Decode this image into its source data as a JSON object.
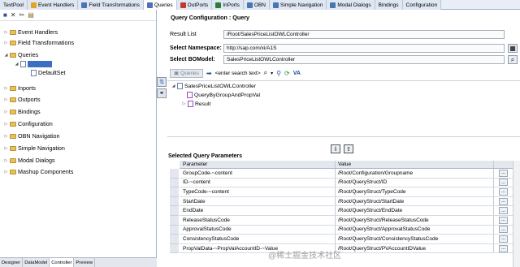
{
  "tabs": [
    {
      "label": "TextPool",
      "icon": "none",
      "color": "",
      "active": false
    },
    {
      "label": "Event Handlers",
      "icon": "lightning-icon",
      "color": "#e2a420",
      "active": false
    },
    {
      "label": "Field Transformations",
      "icon": "transform-icon",
      "color": "#4a74b4",
      "active": false
    },
    {
      "label": "Queries",
      "icon": "query-icon",
      "color": "#4a74b4",
      "active": true
    },
    {
      "label": "OutPorts",
      "icon": "outport-icon",
      "color": "#c0392b",
      "active": false
    },
    {
      "label": "InPorts",
      "icon": "inport-icon",
      "color": "#2e7d32",
      "active": false
    },
    {
      "label": "OBN",
      "icon": "obn-icon",
      "color": "#4a74b4",
      "active": false
    },
    {
      "label": "Simple Navigation",
      "icon": "navigation-icon",
      "color": "#4a74b4",
      "active": false
    },
    {
      "label": "Modal Dialogs",
      "icon": "dialog-icon",
      "color": "#4a74b4",
      "active": false
    },
    {
      "label": "Bindings",
      "icon": "none",
      "color": "",
      "active": false
    },
    {
      "label": "Configuration",
      "icon": "none",
      "color": "",
      "active": false
    }
  ],
  "left_toolbar": {
    "icons": [
      "save-icon",
      "delete-icon",
      "cut-icon",
      "paste-icon"
    ]
  },
  "tree": {
    "items": [
      {
        "label": "Event Handlers"
      },
      {
        "label": "Field Transformations"
      },
      {
        "label": "Queries"
      },
      {
        "label": ""
      },
      {
        "label": "DefaultSet"
      },
      {
        "label": "Inports"
      },
      {
        "label": "Outports"
      },
      {
        "label": "Bindings"
      },
      {
        "label": "Configuration"
      },
      {
        "label": "OBN Navigation"
      },
      {
        "label": "Simple Navigation"
      },
      {
        "label": "Modal Dialogs"
      },
      {
        "label": "Mashup Components"
      }
    ]
  },
  "bottom_tabs": [
    "Designer",
    "DataModel",
    "Controller",
    "Preview"
  ],
  "query_config": {
    "title": "Query Configuration : Query",
    "result_list_label": "Result List",
    "result_list_value": "/Root/SalesPriceListOWLController",
    "namespace_label": "Select Namespace:",
    "namespace_value": "http://sap.com/xi/A1S",
    "bomodel_label": "Select BOModel:",
    "bomodel_value": "SalesPriceListOWLController"
  },
  "query_toolbar": {
    "queries_button": "Queries",
    "search_placeholder": "<enter search text>"
  },
  "query_tree": {
    "root": "SalesPriceListOWLController",
    "children": [
      "QueryByGroupAndPropVal",
      "Result"
    ]
  },
  "params": {
    "section_title": "Selected Query Parameters",
    "col_parameter": "Parameter",
    "col_value": "Value",
    "rows": [
      {
        "parameter": "GroupCode-~content",
        "value": "/Root/Configuration/Groupname"
      },
      {
        "parameter": "ID-~content",
        "value": "/Root/QueryStruct/ID"
      },
      {
        "parameter": "TypeCode-~content",
        "value": "/Root/QueryStruct/TypeCode"
      },
      {
        "parameter": "StartDate",
        "value": "/Root/QueryStruct/StartDate"
      },
      {
        "parameter": "EndDate",
        "value": "/Root/QueryStruct/EndDate"
      },
      {
        "parameter": "ReleaseStatusCode",
        "value": "/Root/QueryStruct/ReleaseStatusCode"
      },
      {
        "parameter": "ApprovalStatusCode",
        "value": "/Root/QueryStruct/ApprovalStatusCode"
      },
      {
        "parameter": "ConsistencyStatusCode",
        "value": "/Root/QueryStruct/ConsistencyStatusCode"
      },
      {
        "parameter": "PropValData-~PropValAccountID-~Value",
        "value": "/Root/QueryStruct/PVAccountIDValue"
      }
    ],
    "row_button": "..."
  },
  "watermark": "@稀土掘金技术社区"
}
